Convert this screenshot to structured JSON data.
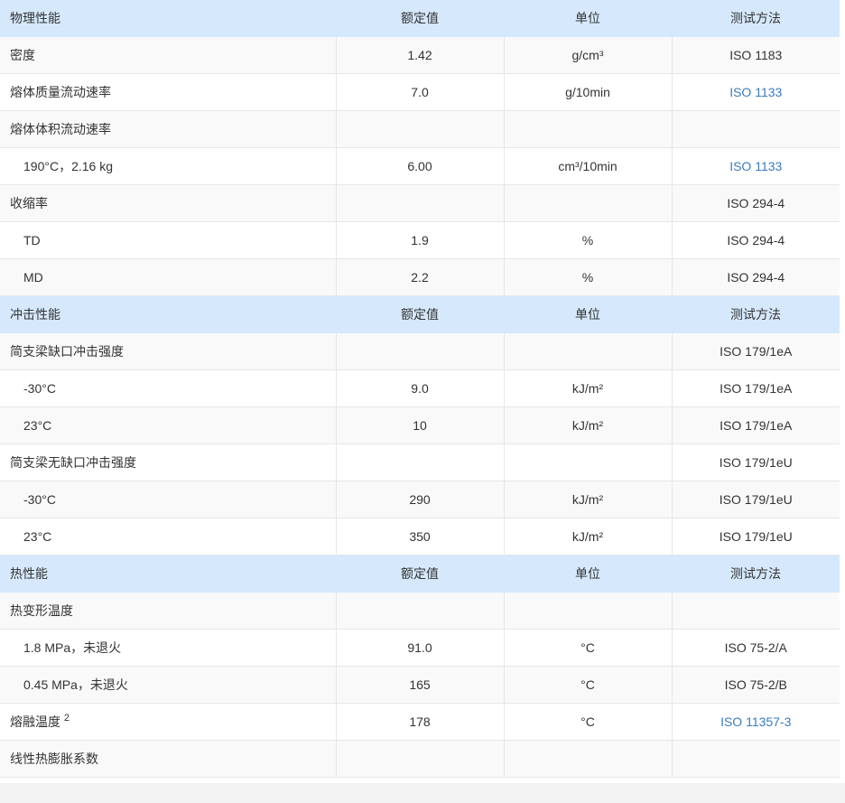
{
  "sections": [
    {
      "header": {
        "title": "物理性能",
        "value_col": "额定值",
        "unit_col": "单位",
        "method_col": "测试方法"
      },
      "rows": [
        {
          "name": "密度",
          "value": "1.42",
          "unit": "g/cm³",
          "method": "ISO 1183",
          "method_link": false
        },
        {
          "name": "熔体质量流动速率",
          "value": "7.0",
          "unit": "g/10min",
          "method": "ISO 1133",
          "method_link": true
        },
        {
          "name": "熔体体积流动速率",
          "value": "",
          "unit": "",
          "method": "",
          "method_link": false
        },
        {
          "name": "190°C，2.16 kg",
          "value": "6.00",
          "unit": "cm³/10min",
          "method": "ISO 1133",
          "method_link": true
        },
        {
          "name": "收缩率",
          "value": "",
          "unit": "",
          "method": "ISO 294-4",
          "method_link": false
        },
        {
          "name": "TD",
          "value": "1.9",
          "unit": "%",
          "method": "ISO 294-4",
          "method_link": false
        },
        {
          "name": "MD",
          "value": "2.2",
          "unit": "%",
          "method": "ISO 294-4",
          "method_link": false
        }
      ]
    },
    {
      "header": {
        "title": "冲击性能",
        "value_col": "额定值",
        "unit_col": "单位",
        "method_col": "测试方法"
      },
      "rows": [
        {
          "name": "简支梁缺口冲击强度",
          "value": "",
          "unit": "",
          "method": "ISO 179/1eA",
          "method_link": false
        },
        {
          "name": "-30°C",
          "value": "9.0",
          "unit": "kJ/m²",
          "method": "ISO 179/1eA",
          "method_link": false
        },
        {
          "name": "23°C",
          "value": "10",
          "unit": "kJ/m²",
          "method": "ISO 179/1eA",
          "method_link": false
        },
        {
          "name": "简支梁无缺口冲击强度",
          "value": "",
          "unit": "",
          "method": "ISO 179/1eU",
          "method_link": false
        },
        {
          "name": "-30°C",
          "value": "290",
          "unit": "kJ/m²",
          "method": "ISO 179/1eU",
          "method_link": false
        },
        {
          "name": "23°C",
          "value": "350",
          "unit": "kJ/m²",
          "method": "ISO 179/1eU",
          "method_link": false
        }
      ]
    },
    {
      "header": {
        "title": "热性能",
        "value_col": "额定值",
        "unit_col": "单位",
        "method_col": "测试方法"
      },
      "rows": [
        {
          "name": "热变形温度",
          "value": "",
          "unit": "",
          "method": "",
          "method_link": false
        },
        {
          "name": "1.8 MPa，未退火",
          "value": "91.0",
          "unit": "°C",
          "method": "ISO 75-2/A",
          "method_link": false
        },
        {
          "name": "0.45 MPa，未退火",
          "value": "165",
          "unit": "°C",
          "method": "ISO 75-2/B",
          "method_link": false
        },
        {
          "name": "熔融温度",
          "note": "2",
          "value": "178",
          "unit": "°C",
          "method": "ISO 11357-3",
          "method_link": true
        },
        {
          "name": "线性热膨胀系数",
          "value": "",
          "unit": "",
          "method": "",
          "method_link": false
        }
      ]
    }
  ],
  "layout_hint": {
    "sub_rows": [
      [
        3,
        5,
        6
      ],
      [
        1,
        2,
        4,
        5
      ],
      [
        1,
        2
      ]
    ]
  },
  "colors": {
    "section_header_bg": "#d6e9fc",
    "row_alt_bg": "#f9f9f9",
    "link": "#3a7bbf",
    "border": "#e6e6e6"
  }
}
